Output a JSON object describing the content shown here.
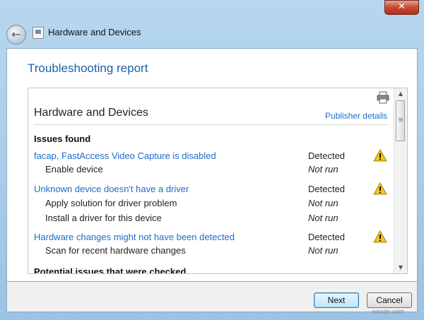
{
  "window": {
    "title": "Hardware and Devices",
    "close_label": "✕"
  },
  "report": {
    "title": "Troubleshooting report",
    "heading": "Hardware and Devices",
    "publisher_link": "Publisher details",
    "issues_section": "Issues found",
    "next_section": "Potential issues that were checked",
    "items": [
      {
        "type": "issue",
        "name": "facap, FastAccess Video Capture is disabled",
        "status": "Detected",
        "icon": "warning-icon"
      },
      {
        "type": "sub",
        "name": "Enable device",
        "status": "Not run"
      },
      {
        "type": "issue",
        "name": "Unknown device doesn't have a driver",
        "status": "Detected",
        "icon": "warning-icon"
      },
      {
        "type": "sub",
        "name": "Apply solution for driver problem",
        "status": "Not run"
      },
      {
        "type": "sub",
        "name": "Install a driver for this device",
        "status": "Not run"
      },
      {
        "type": "issue",
        "name": "Hardware changes might not have been detected",
        "status": "Detected",
        "icon": "warning-icon"
      },
      {
        "type": "sub",
        "name": "Scan for recent hardware changes",
        "status": "Not run"
      }
    ]
  },
  "buttons": {
    "next": "Next",
    "cancel": "Cancel"
  },
  "watermark": "wsxdn.com",
  "colors": {
    "link": "#1e6bc9",
    "title": "#1e5fa8",
    "warning": "#f5c518",
    "close": "#c64a33"
  }
}
